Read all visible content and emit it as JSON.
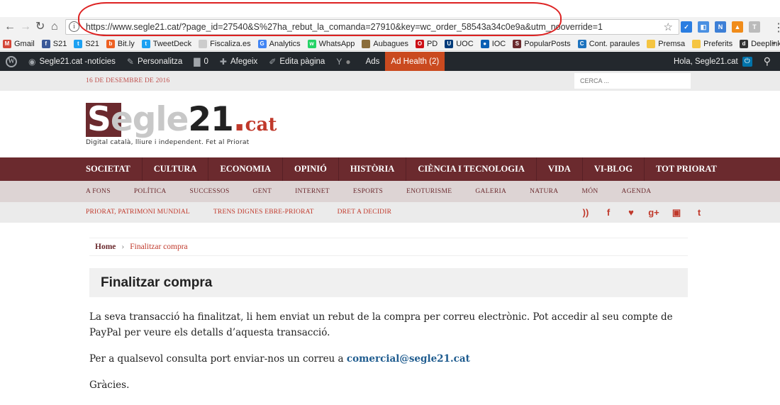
{
  "browser": {
    "url": "https://www.segle21.cat/?page_id=27540&S%27ha_rebut_la_comanda=27910&key=wc_order_58543a34c0e9a&utm_nooverride=1",
    "bookmarks": [
      {
        "label": "Gmail",
        "icon": "gmail-icon",
        "color": "#d44638",
        "glyph": "M"
      },
      {
        "label": "S21",
        "icon": "facebook-icon",
        "color": "#3b5998",
        "glyph": "f"
      },
      {
        "label": "S21",
        "icon": "twitter-icon",
        "color": "#1da1f2",
        "glyph": "t"
      },
      {
        "label": "Bit.ly",
        "icon": "bitly-icon",
        "color": "#ee6123",
        "glyph": "b"
      },
      {
        "label": "TweetDeck",
        "icon": "tweetdeck-icon",
        "color": "#1da1f2",
        "glyph": "t"
      },
      {
        "label": "Fiscaliza.es",
        "icon": "fiscaliza-icon",
        "color": "#cccccc",
        "glyph": ""
      },
      {
        "label": "Analytics",
        "icon": "google-icon",
        "color": "#4285f4",
        "glyph": "G"
      },
      {
        "label": "WhatsApp",
        "icon": "whatsapp-icon",
        "color": "#25d366",
        "glyph": "w"
      },
      {
        "label": "Aubagues",
        "icon": "aubagues-icon",
        "color": "#8a6d3b",
        "glyph": ""
      },
      {
        "label": "PD",
        "icon": "opera-icon",
        "color": "#cc0f16",
        "glyph": "O"
      },
      {
        "label": "UOC",
        "icon": "uoc-icon",
        "color": "#003b7a",
        "glyph": "U"
      },
      {
        "label": "IOC",
        "icon": "ioc-icon",
        "color": "#0a5fb4",
        "glyph": "●"
      },
      {
        "label": "PopularPosts",
        "icon": "s21-icon",
        "color": "#6b2a2e",
        "glyph": "S"
      },
      {
        "label": "Cont. paraules",
        "icon": "counter-icon",
        "color": "#1e73be",
        "glyph": "C"
      },
      {
        "label": "Premsa",
        "icon": "folder-icon",
        "color": "#f5c542",
        "glyph": ""
      },
      {
        "label": "Preferits",
        "icon": "folder-icon",
        "color": "#f5c542",
        "glyph": ""
      },
      {
        "label": "Deeplinkgenerator",
        "icon": "deeplink-icon",
        "color": "#333333",
        "glyph": "d"
      }
    ],
    "more": "»"
  },
  "adminbar": {
    "site": "Segle21.cat -notícies",
    "customize": "Personalitza",
    "comments": "0",
    "add": "Afegeix",
    "edit": "Edita pàgina",
    "ads": "Ads",
    "adhealth": "Ad Health (2)",
    "greeting": "Hola, Segle21.cat"
  },
  "site": {
    "date": "16 DE DESEMBRE DE 2016",
    "search_placeholder": "CERCA ...",
    "logo": {
      "s": "S",
      "eg": "egle",
      "n21": "21",
      "dot": ".",
      "cat": "cat"
    },
    "tagline": "Digital català, lliure i independent. Fet al Priorat",
    "main_nav": [
      "SOCIETAT",
      "CULTURA",
      "ECONOMIA",
      "OPINIÓ",
      "HISTÒRIA",
      "CIÈNCIA I TECNOLOGIA",
      "VIDA",
      "VI-BLOG",
      "TOT PRIORAT"
    ],
    "sub_nav": [
      "A FONS",
      "POLÍTICA",
      "SUCCESSOS",
      "GENT",
      "INTERNET",
      "ESPORTS",
      "ENOTURISME",
      "GALERIA",
      "NATURA",
      "MÓN",
      "AGENDA"
    ],
    "tert_nav": [
      "PRIORAT, PATRIMONI MUNDIAL",
      "TRENS DIGNES EBRE-PRIORAT",
      "DRET A DECIDIR"
    ],
    "social": [
      {
        "name": "rss-icon",
        "glyph": "))"
      },
      {
        "name": "facebook-icon",
        "glyph": "f"
      },
      {
        "name": "twitter-icon",
        "glyph": "♥"
      },
      {
        "name": "googleplus-icon",
        "glyph": "g+"
      },
      {
        "name": "instagram-icon",
        "glyph": "▣"
      },
      {
        "name": "tumblr-icon",
        "glyph": "t"
      }
    ]
  },
  "breadcrumb": {
    "home": "Home",
    "sep": "›",
    "current": "Finalitzar compra"
  },
  "page": {
    "title": "Finalitzar compra",
    "p1": "La seva transacció ha finalitzat, li hem enviat un rebut de la compra per correu electrònic. Pot accedir al seu compte de PayPal per veure els detalls d’aquesta transacció.",
    "p2_prefix": "Per a qualsevol consulta port enviar-nos un correu a ",
    "email": "comercial@segle21.cat",
    "p3": "Gràcies."
  }
}
